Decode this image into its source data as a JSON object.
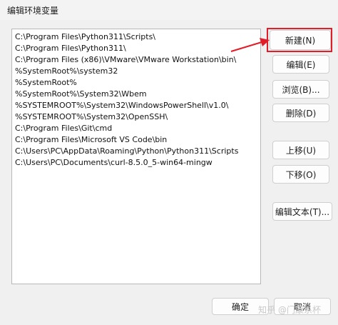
{
  "window": {
    "title": "编辑环境变量"
  },
  "paths": [
    "C:\\Program Files\\Python311\\Scripts\\",
    "C:\\Program Files\\Python311\\",
    "C:\\Program Files (x86)\\VMware\\VMware Workstation\\bin\\",
    "%SystemRoot%\\system32",
    "%SystemRoot%",
    "%SystemRoot%\\System32\\Wbem",
    "%SYSTEMROOT%\\System32\\WindowsPowerShell\\v1.0\\",
    "%SYSTEMROOT%\\System32\\OpenSSH\\",
    "C:\\Program Files\\Git\\cmd",
    "C:\\Program Files\\Microsoft VS Code\\bin",
    "C:\\Users\\PC\\AppData\\Roaming\\Python\\Python311\\Scripts",
    "C:\\Users\\PC\\Documents\\curl-8.5.0_5-win64-mingw"
  ],
  "buttons": {
    "new": "新建(N)",
    "edit": "编辑(E)",
    "browse": "浏览(B)...",
    "delete": "删除(D)",
    "move_up": "上移(U)",
    "move_down": "下移(O)",
    "edit_text": "编辑文本(T)...",
    "ok": "确定",
    "cancel": "取消"
  },
  "watermark": "知乎 @门康系杯",
  "colors": {
    "highlight": "#e11d2a"
  }
}
